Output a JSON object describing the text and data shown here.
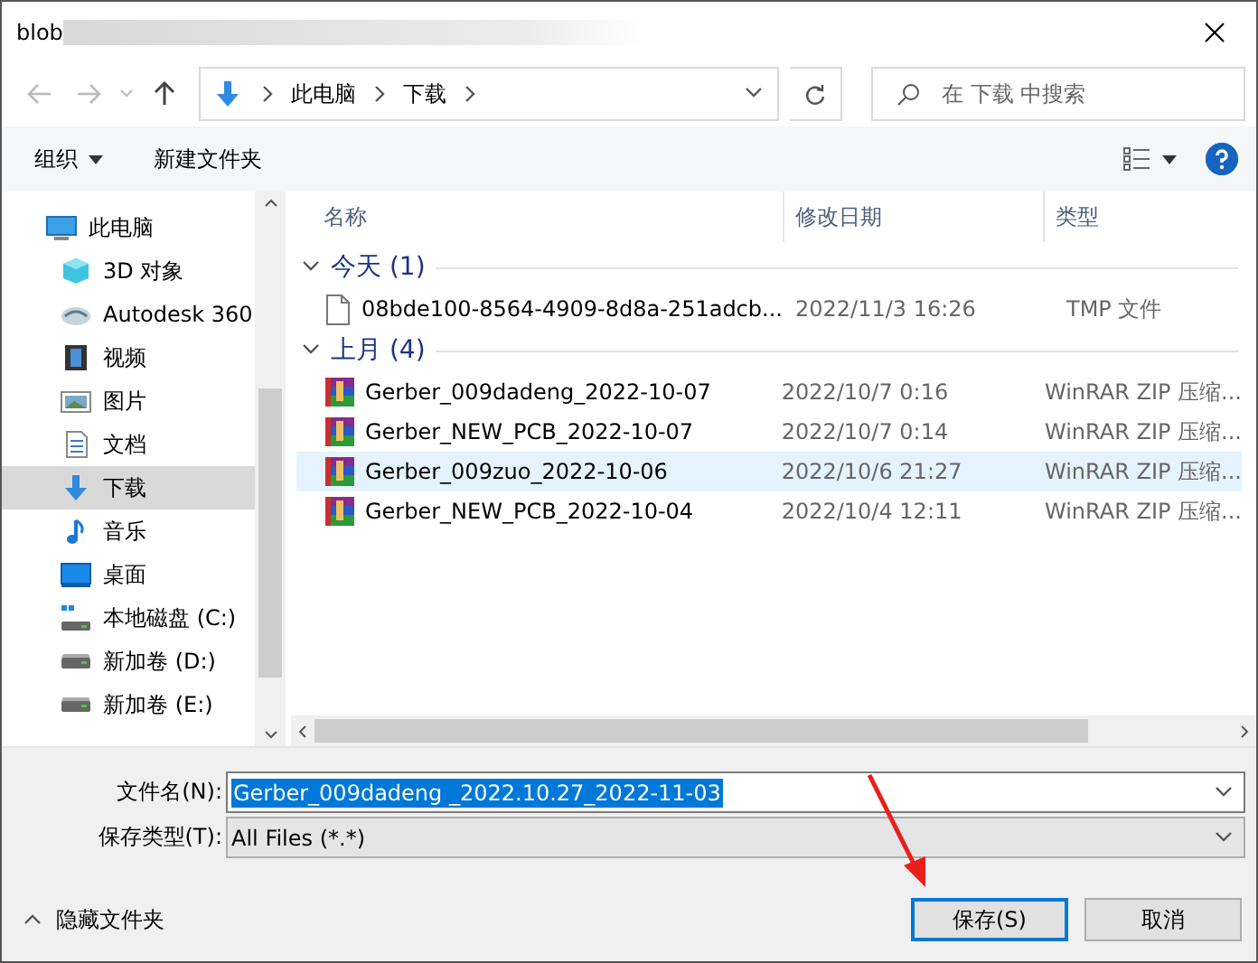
{
  "window": {
    "title": "blob"
  },
  "nav": {
    "breadcrumb": [
      "此电脑",
      "下载"
    ],
    "search": {
      "placeholder": "在 下载 中搜索"
    }
  },
  "toolbar": {
    "organize": "组织",
    "new_folder": "新建文件夹"
  },
  "sidebar": {
    "items": [
      {
        "label": "此电脑",
        "kind": "pc",
        "selected": false,
        "children": [
          {
            "label": "3D 对象",
            "kind": "cube",
            "selected": false
          },
          {
            "label": "Autodesk 360",
            "kind": "cloud",
            "selected": false
          },
          {
            "label": "视频",
            "kind": "video",
            "selected": false
          },
          {
            "label": "图片",
            "kind": "picture",
            "selected": false
          },
          {
            "label": "文档",
            "kind": "document",
            "selected": false
          },
          {
            "label": "下载",
            "kind": "download",
            "selected": true
          },
          {
            "label": "音乐",
            "kind": "music",
            "selected": false
          },
          {
            "label": "桌面",
            "kind": "desktop",
            "selected": false
          },
          {
            "label": "本地磁盘 (C:)",
            "kind": "system-disk",
            "selected": false
          },
          {
            "label": "新加卷 (D:)",
            "kind": "disk",
            "selected": false
          },
          {
            "label": "新加卷 (E:)",
            "kind": "disk",
            "selected": false
          }
        ]
      }
    ]
  },
  "columns": [
    "名称",
    "修改日期",
    "类型"
  ],
  "groups": [
    {
      "title": "今天 (1)",
      "expanded": true,
      "files": [
        {
          "name": "08bde100-8564-4909-8d8a-251adcb...",
          "date": "2022/11/3 16:26",
          "type": "TMP 文件",
          "kind": "file",
          "selected": false
        }
      ]
    },
    {
      "title": "上月 (4)",
      "expanded": true,
      "files": [
        {
          "name": "Gerber_009dadeng_2022-10-07",
          "date": "2022/10/7 0:16",
          "type": "WinRAR ZIP 压缩...",
          "kind": "archive",
          "selected": false
        },
        {
          "name": "Gerber_NEW_PCB_2022-10-07",
          "date": "2022/10/7 0:14",
          "type": "WinRAR ZIP 压缩...",
          "kind": "archive",
          "selected": false
        },
        {
          "name": "Gerber_009zuo_2022-10-06",
          "date": "2022/10/6 21:27",
          "type": "WinRAR ZIP 压缩...",
          "kind": "archive",
          "selected": true
        },
        {
          "name": "Gerber_NEW_PCB_2022-10-04",
          "date": "2022/10/4 12:11",
          "type": "WinRAR ZIP 压缩...",
          "kind": "archive",
          "selected": false
        }
      ]
    }
  ],
  "form": {
    "filename_label": "文件名(N):",
    "filename": "Gerber_009dadeng _2022.10.27_2022-11-03",
    "type_label": "保存类型(T):",
    "type": "All Files (*.*)"
  },
  "footer": {
    "hide_folders": "隐藏文件夹",
    "buttons": [
      {
        "label": "保存(S)",
        "kind": "primary"
      },
      {
        "label": "取消",
        "kind": "secondary"
      }
    ]
  }
}
